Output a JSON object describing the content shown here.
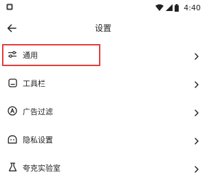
{
  "status_bar": {
    "time": "4:40",
    "app_icon": "app-notification-icon",
    "icons": [
      "wifi-icon",
      "cellular-signal-icon",
      "battery-icon"
    ]
  },
  "header": {
    "title": "设置",
    "back_icon": "arrow-left-icon"
  },
  "settings": {
    "items": [
      {
        "label": "通用",
        "icon": "sliders-icon",
        "highlighted": true
      },
      {
        "label": "工具栏",
        "icon": "toolbar-icon"
      },
      {
        "label": "广告过滤",
        "icon": "ad-filter-icon"
      },
      {
        "label": "隐私设置",
        "icon": "privacy-mask-icon"
      },
      {
        "label": "夸克实验室",
        "icon": "flask-icon"
      }
    ]
  },
  "colors": {
    "highlight_border": "#e33b3b",
    "text": "#222222",
    "background": "#ffffff"
  }
}
